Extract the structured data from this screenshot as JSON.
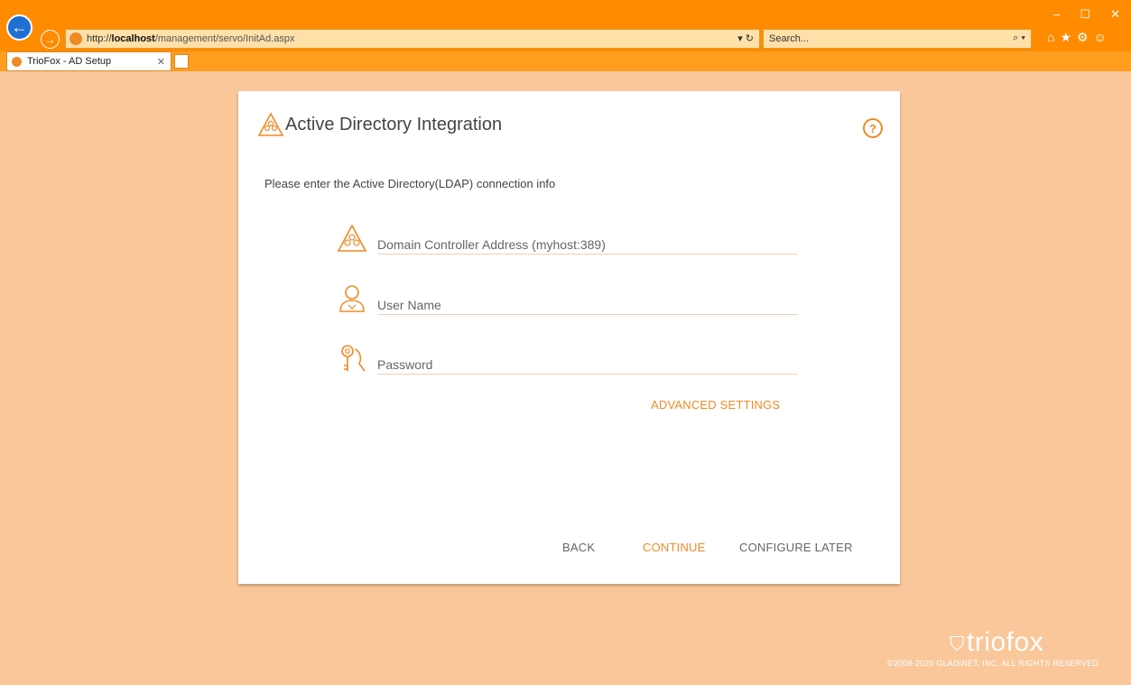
{
  "browser": {
    "url_prefix": "http://",
    "url_host": "localhost",
    "url_path": "/management/servo/InitAd.aspx",
    "search_placeholder": "Search...",
    "tab_title": "TrioFox - AD Setup"
  },
  "card": {
    "title": "Active Directory Integration",
    "help_glyph": "?",
    "intro": "Please enter the Active Directory(LDAP) connection info",
    "fields": {
      "domain_placeholder": "Domain Controller Address (myhost:389)",
      "username_placeholder": "User Name",
      "password_placeholder": "Password"
    },
    "advanced_label": "ADVANCED SETTINGS",
    "buttons": {
      "back": "BACK",
      "continue": "CONTINUE",
      "configure_later": "CONFIGURE LATER"
    }
  },
  "footer": {
    "logo_text": "triofox",
    "copyright": "©2008-2020 GLADINET, INC. ALL RIGHTS RESERVED"
  },
  "colors": {
    "accent": "#f08a24",
    "chrome": "#ff8c00",
    "page_bg": "#f9c79a"
  }
}
